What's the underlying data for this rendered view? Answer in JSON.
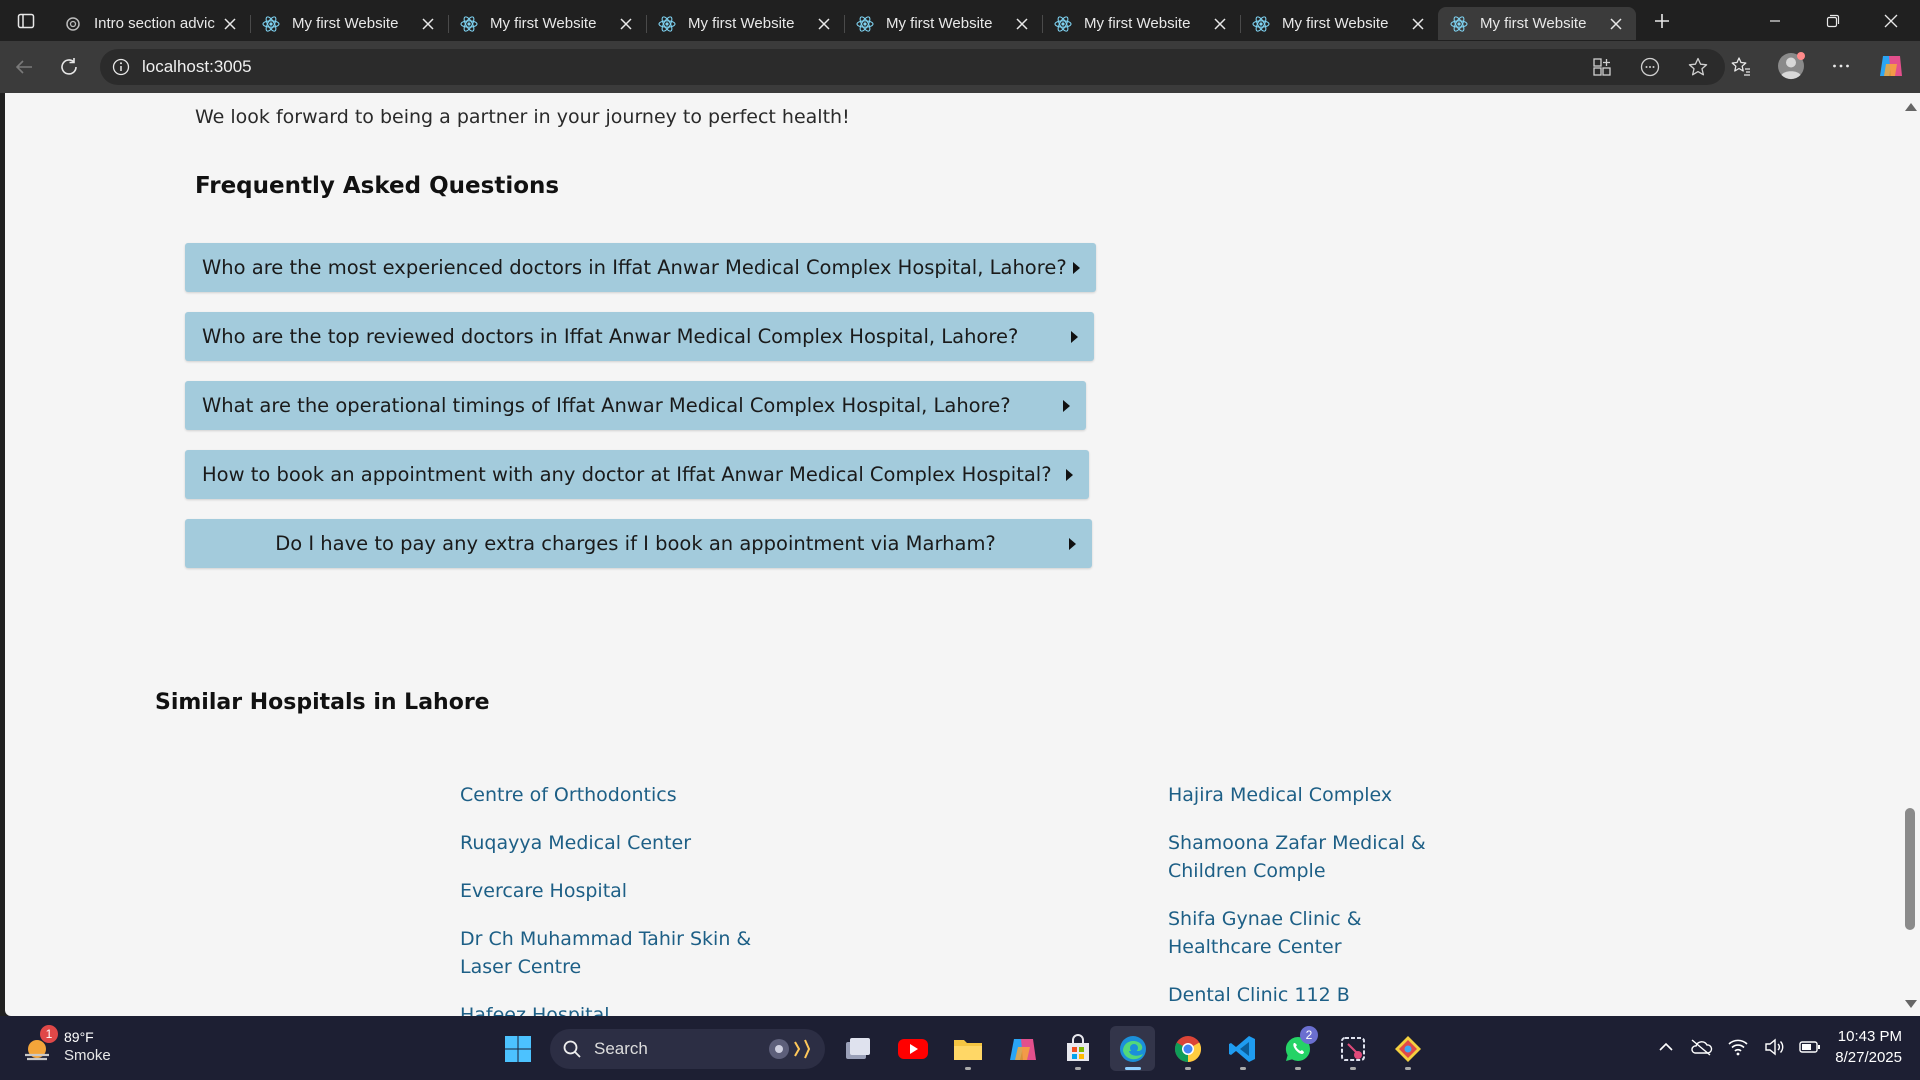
{
  "browser": {
    "tabs": [
      {
        "title": "Intro section advic",
        "active": false,
        "icon": "openai-icon"
      },
      {
        "title": "My first Website",
        "active": false,
        "icon": "react-icon"
      },
      {
        "title": "My first Website",
        "active": false,
        "icon": "react-icon"
      },
      {
        "title": "My first Website",
        "active": false,
        "icon": "react-icon"
      },
      {
        "title": "My first Website",
        "active": false,
        "icon": "react-icon"
      },
      {
        "title": "My first Website",
        "active": false,
        "icon": "react-icon"
      },
      {
        "title": "My first Website",
        "active": false,
        "icon": "react-icon"
      },
      {
        "title": "My first Website",
        "active": true,
        "icon": "react-icon"
      }
    ],
    "url": "localhost:3005"
  },
  "page": {
    "intro_text": "We look forward to being a partner in your journey to perfect health!",
    "faq_heading": "Frequently Asked Questions",
    "faq": [
      "Who are the most experienced doctors in Iffat Anwar Medical Complex Hospital, Lahore?",
      "Who are the top reviewed doctors in Iffat Anwar Medical Complex Hospital, Lahore?",
      "What are the operational timings of Iffat Anwar Medical Complex Hospital, Lahore?",
      "How to book an appointment with any doctor at Iffat Anwar Medical Complex Hospital?",
      "Do I have to pay any extra charges if I book an appointment via Marham?"
    ],
    "similar_heading": "Similar Hospitals in Lahore",
    "hospitals_left": [
      "Centre of Orthodontics",
      "Ruqayya Medical Center",
      "Evercare Hospital",
      "Dr Ch Muhammad Tahir Skin & Laser Centre",
      "Hafeez Hospital"
    ],
    "hospitals_right": [
      "Hajira Medical Complex",
      "Shamoona Zafar Medical & Children Comple",
      "Shifa Gynae Clinic & Healthcare Center",
      "Dental Clinic 112 B"
    ]
  },
  "taskbar": {
    "weather_temp": "89°F",
    "weather_condition": "Smoke",
    "weather_badge": "1",
    "search_placeholder": "Search",
    "whatsapp_badge": "2",
    "time": "10:43 PM",
    "date": "8/27/2025"
  },
  "colors": {
    "faq_bg": "#a3cbdc",
    "link": "#1d5f86",
    "page_bg": "#f5f5f5"
  }
}
